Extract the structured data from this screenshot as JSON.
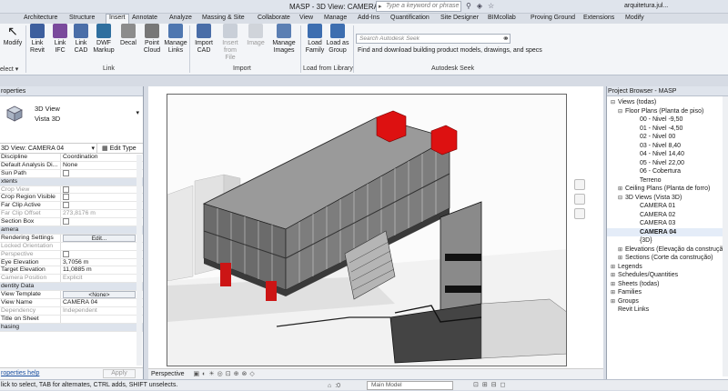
{
  "titlebar": {
    "title": "MASP - 3D View: CAMERA 04",
    "search_placeholder": "Type a keyword or phrase",
    "user": "arquitetura.jul..."
  },
  "tabs": [
    "Architecture",
    "Structure",
    "Insert",
    "Annotate",
    "Analyze",
    "Massing & Site",
    "Collaborate",
    "View",
    "Manage",
    "Add-Ins",
    "Quantification",
    "Site Designer",
    "BIMcollab",
    "Proving Ground",
    "Extensions",
    "Modify"
  ],
  "active_tab": "Insert",
  "ribbon": {
    "modify_label": "Modify",
    "select_label": "elect ▾",
    "link_panel": {
      "name": "Link",
      "buttons": [
        "Link Revit",
        "Link IFC",
        "Link CAD",
        "DWF Markup",
        "Decal",
        "Point Cloud",
        "Manage Links"
      ]
    },
    "import_panel": {
      "name": "Import",
      "buttons": [
        "Import CAD",
        "Insert from File",
        "Image",
        "Manage Images"
      ]
    },
    "library_panel": {
      "name": "Load from Library",
      "buttons": [
        "Load Family",
        "Load as Group"
      ]
    },
    "seek_panel": {
      "name": "Autodesk Seek",
      "placeholder": "Search Autodesk Seek",
      "description": "Find and download building product models, drawings, and specs"
    }
  },
  "properties": {
    "header": "roperties",
    "type_line1": "3D View",
    "type_line2": "Vista 3D",
    "instance_filter": "3D View: CAMERA 04",
    "edit_type": "Edit Type",
    "rows": [
      {
        "k": "Discipline",
        "v": "Coordination"
      },
      {
        "k": "Default Analysis Di...",
        "v": "None"
      },
      {
        "k": "Sun Path",
        "v": "",
        "check": true
      },
      {
        "k": "xtents",
        "group": true
      },
      {
        "k": "Crop View",
        "v": "",
        "check": true,
        "disabled": true
      },
      {
        "k": "Crop Region Visible",
        "v": "",
        "check": true
      },
      {
        "k": "Far Clip Active",
        "v": "",
        "check": true
      },
      {
        "k": "Far Clip Offset",
        "v": "273,8176 m",
        "disabled": true
      },
      {
        "k": "Section Box",
        "v": "",
        "check": true
      },
      {
        "k": "amera",
        "group": true
      },
      {
        "k": "Rendering Settings",
        "v": "Edit...",
        "button": true
      },
      {
        "k": "Locked Orientation",
        "v": "",
        "disabled": true
      },
      {
        "k": "Perspective",
        "v": "",
        "check": true,
        "disabled": true
      },
      {
        "k": "Eye Elevation",
        "v": "3,7056 m"
      },
      {
        "k": "Target Elevation",
        "v": "11,0885 m"
      },
      {
        "k": "Camera Position",
        "v": "Explicit",
        "disabled": true
      },
      {
        "k": "dentity Data",
        "group": true
      },
      {
        "k": "View Template",
        "v": "<None>",
        "button": true
      },
      {
        "k": "View Name",
        "v": "CAMERA 04"
      },
      {
        "k": "Dependency",
        "v": "Independent",
        "disabled": true
      },
      {
        "k": "Title on Sheet",
        "v": ""
      },
      {
        "k": "hasing",
        "group": true
      }
    ],
    "help_link": "roperties help",
    "apply": "Apply"
  },
  "view": {
    "scale_label": "Perspective"
  },
  "project_browser": {
    "header": "Project Browser - MASP",
    "items": [
      {
        "label": "Views (todas)",
        "indent": 0,
        "exp": "⊟"
      },
      {
        "label": "Floor Plans (Planta de piso)",
        "indent": 1,
        "exp": "⊟"
      },
      {
        "label": "00 - Nivel -9,50",
        "indent": 3
      },
      {
        "label": "01 - Nivel -4,50",
        "indent": 3
      },
      {
        "label": "02 - Nivel 00",
        "indent": 3
      },
      {
        "label": "03 - Nivel 8,40",
        "indent": 3
      },
      {
        "label": "04 - Nivel 14,40",
        "indent": 3
      },
      {
        "label": "05 - Nivel 22,00",
        "indent": 3
      },
      {
        "label": "06 - Cobertura",
        "indent": 3
      },
      {
        "label": "Terreno",
        "indent": 3
      },
      {
        "label": "Ceiling Plans (Planta de forro)",
        "indent": 1,
        "exp": "⊞"
      },
      {
        "label": "3D Views (Vista 3D)",
        "indent": 1,
        "exp": "⊟"
      },
      {
        "label": "CAMERA 01",
        "indent": 3
      },
      {
        "label": "CAMERA 02",
        "indent": 3
      },
      {
        "label": "CAMERA 03",
        "indent": 3
      },
      {
        "label": "CAMERA 04",
        "indent": 3,
        "bold": true
      },
      {
        "label": "{3D}",
        "indent": 3
      },
      {
        "label": "Elevations (Elevação da construção)",
        "indent": 1,
        "exp": "⊞"
      },
      {
        "label": "Sections (Corte da construção)",
        "indent": 1,
        "exp": "⊞"
      },
      {
        "label": "Legends",
        "indent": 0,
        "exp": "⊞"
      },
      {
        "label": "Schedules/Quantities",
        "indent": 0,
        "exp": "⊞"
      },
      {
        "label": "Sheets (todas)",
        "indent": 0,
        "exp": "⊞"
      },
      {
        "label": "Families",
        "indent": 0,
        "exp": "⊞"
      },
      {
        "label": "Groups",
        "indent": 0,
        "exp": "⊞"
      },
      {
        "label": "Revit Links",
        "indent": 0
      }
    ]
  },
  "status": {
    "text": "lick to select, TAB for alternates, CTRL adds, SHIFT unselects.",
    "model": "Main Model",
    "counter": ":0"
  },
  "colors": {
    "accent_red": "#dd1111",
    "ribbon_bg": "#f3f5f8",
    "panel_header": "#dfe4ec"
  }
}
